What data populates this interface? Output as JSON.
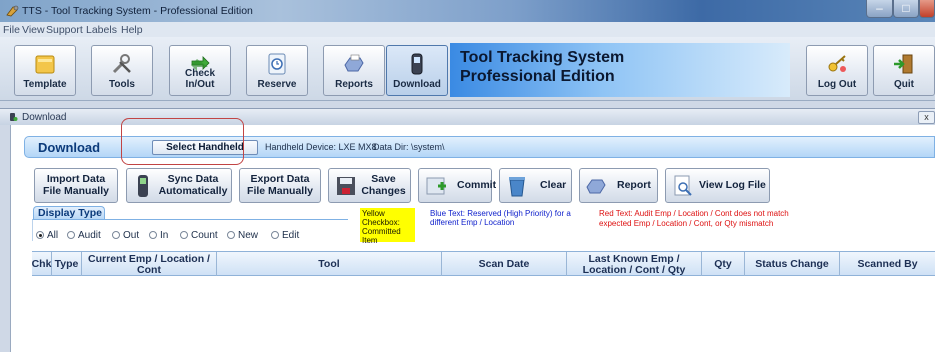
{
  "window": {
    "title": "TTS - Tool Tracking System - Professional Edition"
  },
  "menu": [
    "File",
    "View",
    "Support",
    "Labels",
    "Help"
  ],
  "toolbar": {
    "buttons": [
      {
        "label": "Template",
        "icon": "folder-icon"
      },
      {
        "label": "Tools",
        "icon": "tools-icon"
      },
      {
        "label": "Check In/Out",
        "icon": "arrows-icon"
      },
      {
        "label": "Reserve",
        "icon": "clock-icon"
      },
      {
        "label": "Reports",
        "icon": "printer-icon"
      },
      {
        "label": "Download",
        "icon": "handheld-icon"
      }
    ],
    "banner_line1": "Tool Tracking System",
    "banner_line2": "Professional Edition",
    "logout_label": "Log Out",
    "quit_label": "Quit"
  },
  "subwindow": {
    "title": "Download",
    "close": "x"
  },
  "download": {
    "title": "Download",
    "select_handheld": "Select Handheld",
    "handheld_device": "Handheld Device:  LXE MX8",
    "data_dir": "Data Dir:  \\system\\"
  },
  "actions": {
    "import_1": "Import Data",
    "import_2": "File Manually",
    "sync_1": "Sync Data",
    "sync_2": "Automatically",
    "export_1": "Export Data",
    "export_2": "File Manually",
    "save_1": "Save",
    "save_2": "Changes",
    "commit": "Commit",
    "clear": "Clear",
    "report": "Report",
    "view_log": "View Log File"
  },
  "display_type": {
    "label": "Display Type",
    "options": [
      "All",
      "Audit",
      "Out",
      "In",
      "Count",
      "New",
      "Edit"
    ],
    "selected": "All"
  },
  "legend": {
    "yellow": "Yellow Checkbox: Committed Item",
    "blue": "Blue Text:  Reserved (High Priority) for a different Emp / Location",
    "red": "Red Text:  Audit Emp / Location / Cont does not match expected Emp / Location / Cont, or Qty mismatch"
  },
  "table": {
    "columns": [
      "Chk",
      "Type",
      "Current Emp / Location / Cont",
      "Tool",
      "Scan Date",
      "Last Known Emp / Location / Cont / Qty",
      "Qty",
      "Status Change",
      "Scanned By"
    ]
  },
  "colors": {
    "accent": "#0b3a7a",
    "highlight": "#c14444",
    "legend_yellow": "#ffff00",
    "legend_blue": "#1122cc",
    "legend_red": "#dd1111"
  }
}
